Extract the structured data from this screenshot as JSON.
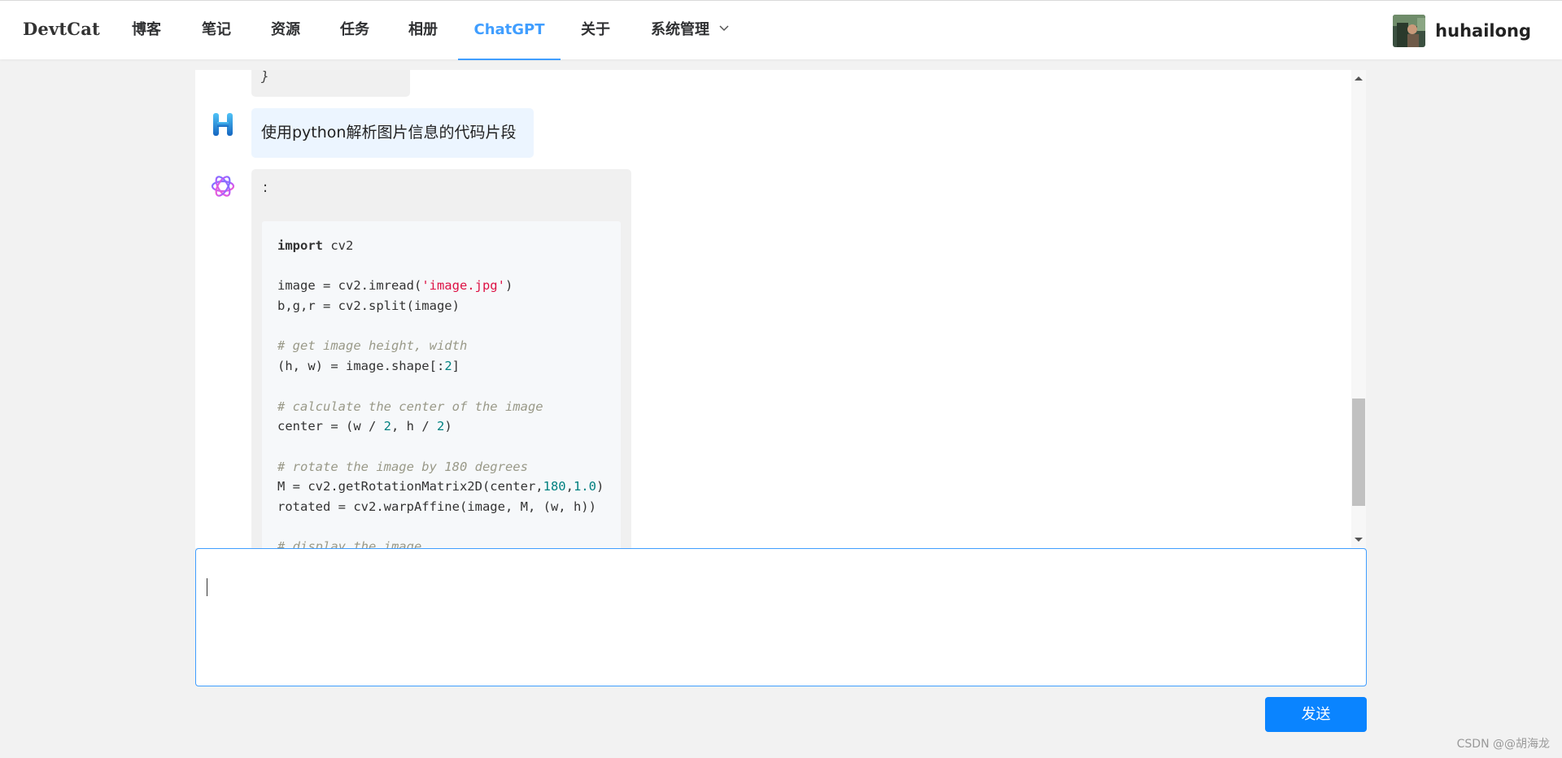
{
  "header": {
    "logo": "DevtCat",
    "nav": [
      "博客",
      "笔记",
      "资源",
      "任务",
      "相册",
      "ChatGPT",
      "关于",
      "系统管理"
    ],
    "active": "ChatGPT",
    "user": {
      "name": "huhailong",
      "avatar_icon": "user-avatar-photo"
    }
  },
  "chat": {
    "previous_fragment": "}",
    "user_message": "使用python解析图片信息的代码片段",
    "bot_prefix": ":",
    "code": [
      [
        {
          "t": "kw",
          "v": "import"
        },
        {
          "t": "p",
          "v": " cv2"
        }
      ],
      [],
      [
        {
          "t": "p",
          "v": "image = cv2.imread("
        },
        {
          "t": "str",
          "v": "'image.jpg'"
        },
        {
          "t": "p",
          "v": ")"
        }
      ],
      [
        {
          "t": "p",
          "v": "b,g,r = cv2.split(image)"
        }
      ],
      [],
      [
        {
          "t": "cmt",
          "v": "# get image height, width"
        }
      ],
      [
        {
          "t": "p",
          "v": "(h, w) = image.shape[:"
        },
        {
          "t": "num",
          "v": "2"
        },
        {
          "t": "p",
          "v": "]"
        }
      ],
      [],
      [
        {
          "t": "cmt",
          "v": "# calculate the center of the image"
        }
      ],
      [
        {
          "t": "p",
          "v": "center = (w / "
        },
        {
          "t": "num",
          "v": "2"
        },
        {
          "t": "p",
          "v": ", h / "
        },
        {
          "t": "num",
          "v": "2"
        },
        {
          "t": "p",
          "v": ")"
        }
      ],
      [],
      [
        {
          "t": "cmt",
          "v": "# rotate the image by 180 degrees"
        }
      ],
      [
        {
          "t": "p",
          "v": "M = cv2.getRotationMatrix2D(center,"
        },
        {
          "t": "num",
          "v": "180"
        },
        {
          "t": "p",
          "v": ","
        },
        {
          "t": "num",
          "v": "1.0"
        },
        {
          "t": "p",
          "v": ")"
        }
      ],
      [
        {
          "t": "p",
          "v": "rotated = cv2.warpAffine(image, M, (w, h))"
        }
      ],
      [],
      [
        {
          "t": "cmt",
          "v": "# display the image"
        }
      ]
    ]
  },
  "input": {
    "value": ""
  },
  "send_label": "发送",
  "watermark": "CSDN @@胡海龙",
  "colors": {
    "accent": "#409eff",
    "send": "#0a84ff",
    "user_bubble": "#ecf5ff",
    "bot_bubble": "#f0f0f0"
  }
}
